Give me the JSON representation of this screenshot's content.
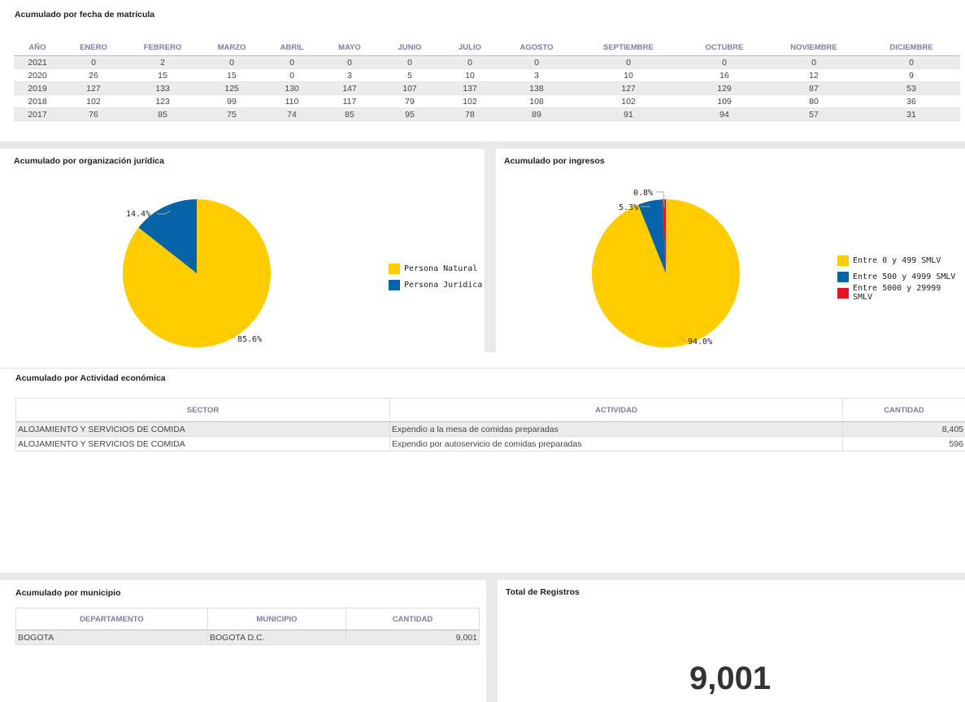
{
  "sections": {
    "fecha_title": "Acumulado por fecha de matrícula",
    "juridica_title": "Acumulado por organización jurídica",
    "ingresos_title": "Acumulado por ingresos",
    "actividad_title": "Acumulado por Actividad económica",
    "municipio_title": "Acumulado por municipio",
    "total_title": "Total de Registros"
  },
  "month_table": {
    "headers": [
      "AÑO",
      "ENERO",
      "FEBRERO",
      "MARZO",
      "ABRIL",
      "MAYO",
      "JUNIO",
      "JULIO",
      "AGOSTO",
      "SEPTIEMBRE",
      "OCTUBRE",
      "NOVIEMBRE",
      "DICIEMBRE"
    ],
    "rows": [
      [
        "2021",
        "0",
        "2",
        "0",
        "0",
        "0",
        "0",
        "0",
        "0",
        "0",
        "0",
        "0",
        "0"
      ],
      [
        "2020",
        "26",
        "15",
        "15",
        "0",
        "3",
        "5",
        "10",
        "3",
        "10",
        "16",
        "12",
        "9"
      ],
      [
        "2019",
        "127",
        "133",
        "125",
        "130",
        "147",
        "107",
        "137",
        "138",
        "127",
        "129",
        "87",
        "53"
      ],
      [
        "2018",
        "102",
        "123",
        "99",
        "110",
        "117",
        "79",
        "102",
        "108",
        "102",
        "109",
        "80",
        "36"
      ],
      [
        "2017",
        "76",
        "85",
        "75",
        "74",
        "85",
        "95",
        "78",
        "89",
        "91",
        "94",
        "57",
        "31"
      ]
    ]
  },
  "chart_data": [
    {
      "type": "pie",
      "title": "Acumulado por organización jurídica",
      "categories": [
        "Persona Natural",
        "Persona Juridica"
      ],
      "values": [
        85.6,
        14.4
      ],
      "labels": [
        "85.6%",
        "14.4%"
      ],
      "colors": [
        "#ffcc00",
        "#0565a8"
      ],
      "legend": "right"
    },
    {
      "type": "pie",
      "title": "Acumulado por ingresos",
      "categories": [
        "Entre 0 y 499 SMLV",
        "Entre 500 y 4999 SMLV",
        "Entre 5000 y 29999 SMLV"
      ],
      "values": [
        94.0,
        5.3,
        0.8
      ],
      "labels": [
        "94.0%",
        "5.3%",
        "0.8%"
      ],
      "colors": [
        "#ffcc00",
        "#0565a8",
        "#e3161f"
      ],
      "legend": "right"
    }
  ],
  "activity_table": {
    "headers": [
      "SECTOR",
      "ACTIVIDAD",
      "CANTIDAD"
    ],
    "rows": [
      [
        "ALOJAMIENTO Y SERVICIOS DE COMIDA",
        "Expendio a la mesa de comidas preparadas",
        "8,405"
      ],
      [
        "ALOJAMIENTO Y SERVICIOS DE COMIDA",
        "Expendio por autoservicio de comidas preparadas",
        "596"
      ]
    ]
  },
  "municipio_table": {
    "headers": [
      "DEPARTAMENTO",
      "MUNICIPIO",
      "CANTIDAD"
    ],
    "rows": [
      [
        "BOGOTA",
        "BOGOTA D.C.",
        "9,001"
      ]
    ]
  },
  "total": {
    "value": "9,001"
  }
}
